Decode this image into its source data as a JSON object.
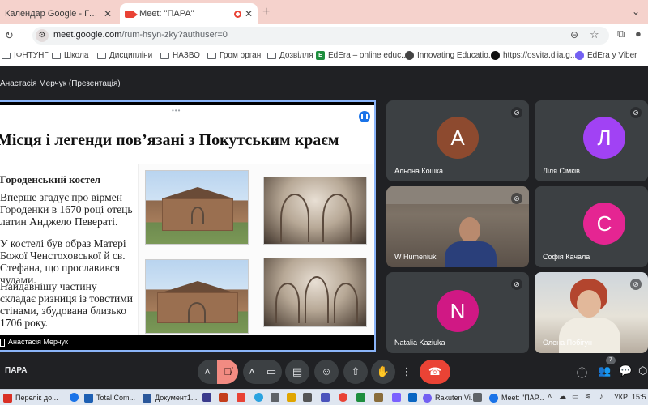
{
  "browser": {
    "tabs": [
      {
        "title": "Календар Google - Графік поч",
        "active": false
      },
      {
        "title": "Meet: \"ПАРА\"",
        "active": true
      }
    ],
    "new_tab_label": "+",
    "url_host": "meet.google.com",
    "url_path": "/rum-hsyn-zky?authuser=0",
    "bookmarks": [
      "ІФНТУНГ",
      "Школа",
      "Дисципліни",
      "НАЗВО",
      "Гром орган",
      "Дозвілля",
      "EdEra – online educ...",
      "Innovating Educatio...",
      "https://osvita.diia.g...",
      "EdEra y Viber"
    ]
  },
  "meet": {
    "presenter_title": "Анастасія Мерчук (Презентація)",
    "slide": {
      "title": "Місця і легенди пов’язані з Покутським краєм",
      "heading": "Городенський костел",
      "paragraphs": [
        "Вперше згадує про вірмен Городенки в 1670 році отець латин Анджело Певераті.",
        "У костелі був образ Матері Божої Ченстоховської й св. Стефана, що прославився чудами.",
        "Найдавнішу частину складає ризниця із товстими стінами, збудована близько 1706 року."
      ],
      "footer_name": "Анастасія Мерчук"
    },
    "participants": [
      {
        "name": "Альона Кошка",
        "initial": "А",
        "color": "#8d4a2f",
        "muted": true
      },
      {
        "name": "Ліля Сімків",
        "initial": "Л",
        "color": "#a142f4",
        "muted": true
      },
      {
        "name": "W Humeniuk",
        "initial": "",
        "color": "",
        "muted": true,
        "video": true
      },
      {
        "name": "Софія Качала",
        "initial": "С",
        "color": "#e52592",
        "muted": true
      },
      {
        "name": "Natalia Kaziuka",
        "initial": "N",
        "color": "#d01884",
        "muted": true
      },
      {
        "name": "Олена Побігун",
        "initial": "",
        "color": "",
        "muted": true,
        "video": true
      }
    ],
    "meeting_name": "ПАРА",
    "people_count": "7",
    "accent_red": "#ea4335",
    "mic_off_color": "#f28b82"
  },
  "taskbar": {
    "items": [
      "Перелік до...",
      "Total Com...",
      "Документ1...",
      "Rakuten Vi...",
      "Meet: \"ПАР..."
    ],
    "language": "УКР",
    "time": "15:5"
  }
}
